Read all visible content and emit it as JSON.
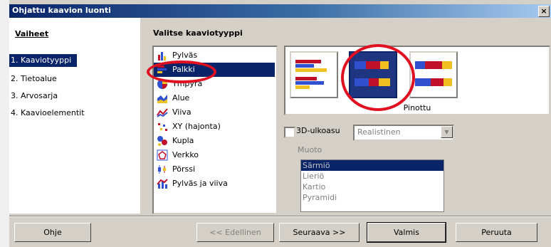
{
  "window": {
    "title": "Ohjattu kaavion luonti",
    "close": "×"
  },
  "steps": {
    "title": "Vaiheet",
    "items": [
      "1. Kaaviotyyppi",
      "2. Tietoalue",
      "3. Arvosarja",
      "4. Kaavioelementit"
    ],
    "selected_index": 0
  },
  "content": {
    "title": "Valitse kaaviotyyppi"
  },
  "chart_types": {
    "items": [
      "Pylväs",
      "Palkki",
      "Ympyrä",
      "Alue",
      "Viiva",
      "XY (hajonta)",
      "Kupla",
      "Verkko",
      "Pörssi",
      "Pylväs ja viiva"
    ],
    "selected_index": 1
  },
  "variants": {
    "selected_label": "Pinottu",
    "selected_index": 1
  },
  "three_d": {
    "label": "3D-ulkoasu",
    "checked": false,
    "combo_value": "Realistinen"
  },
  "shape": {
    "label": "Muoto",
    "items": [
      "Särmiö",
      "Lieriö",
      "Kartio",
      "Pyramidi"
    ],
    "selected_index": 0
  },
  "buttons": {
    "help": "Ohje",
    "back": "<< Edellinen",
    "next": "Seuraava >>",
    "finish": "Valmis",
    "cancel": "Peruuta"
  },
  "colors": {
    "accent": "#0a246a",
    "bar_red": "#c0102a",
    "bar_blue": "#3050d0",
    "bar_yellow": "#f0c020",
    "highlight_circle": "#e01020"
  }
}
